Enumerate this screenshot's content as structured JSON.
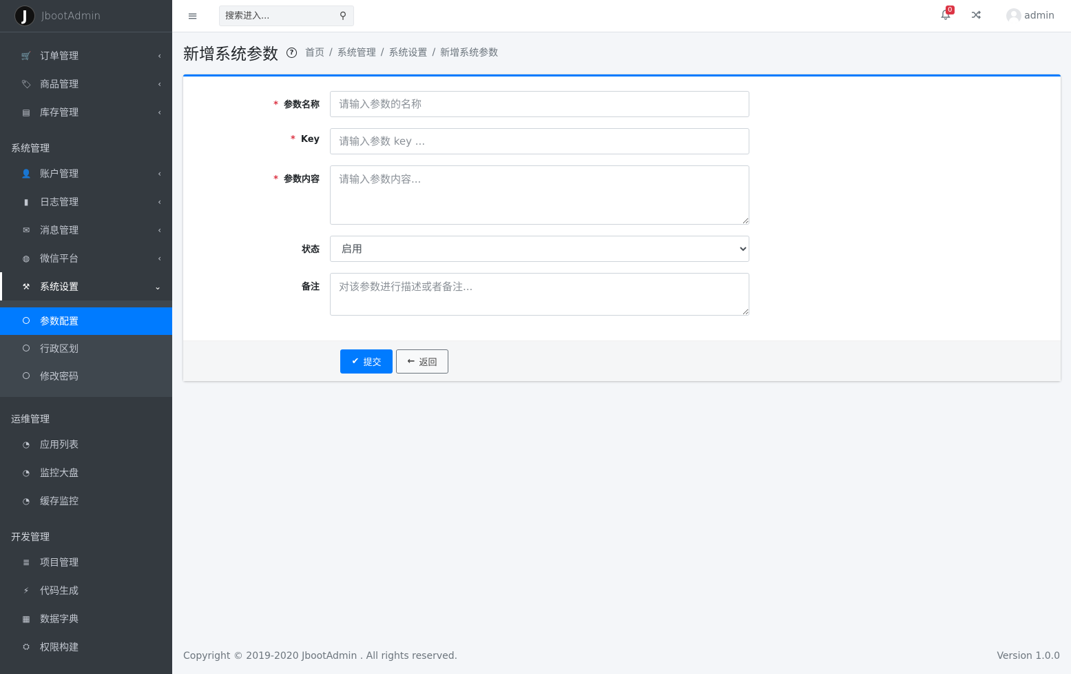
{
  "brand": {
    "logo_letter": "J",
    "name": "JbootAdmin"
  },
  "sidebar": {
    "group1": [
      {
        "icon": "🛒",
        "icon_name": "cart-icon",
        "label": "订单管理",
        "chev": "‹"
      },
      {
        "icon": "🏷",
        "icon_name": "tag-icon",
        "label": "商品管理",
        "chev": "‹"
      },
      {
        "icon": "▤",
        "icon_name": "warehouse-icon",
        "label": "库存管理",
        "chev": "‹"
      }
    ],
    "header_system": "系统管理",
    "group2": [
      {
        "icon": "👤",
        "icon_name": "user-icon",
        "label": "账户管理",
        "chev": "‹"
      },
      {
        "icon": "▮",
        "icon_name": "book-icon",
        "label": "日志管理",
        "chev": "‹"
      },
      {
        "icon": "✉",
        "icon_name": "message-icon",
        "label": "消息管理",
        "chev": "‹"
      },
      {
        "icon": "◍",
        "icon_name": "wechat-icon",
        "label": "微信平台",
        "chev": "‹"
      }
    ],
    "open_item": {
      "icon": "⚒",
      "icon_name": "wrench-icon",
      "label": "系统设置",
      "chev": "⌄"
    },
    "sub_items": [
      {
        "label": "参数配置",
        "active": true
      },
      {
        "label": "行政区划",
        "active": false
      },
      {
        "label": "修改密码",
        "active": false
      }
    ],
    "header_ops": "运维管理",
    "group3": [
      {
        "icon": "◔",
        "icon_name": "dashboard-icon",
        "label": "应用列表"
      },
      {
        "icon": "◔",
        "icon_name": "dashboard-icon",
        "label": "监控大盘"
      },
      {
        "icon": "◔",
        "icon_name": "dashboard-icon",
        "label": "缓存监控"
      }
    ],
    "header_dev": "开发管理",
    "group4": [
      {
        "icon": "≣",
        "icon_name": "database-icon",
        "label": "项目管理"
      },
      {
        "icon": "⚡",
        "icon_name": "bolt-icon",
        "label": "代码生成"
      },
      {
        "icon": "▦",
        "icon_name": "grid-icon",
        "label": "数据字典"
      },
      {
        "icon": "⛭",
        "icon_name": "sitemap-icon",
        "label": "权限构建"
      }
    ]
  },
  "topbar": {
    "menu_icon": "≡",
    "search_placeholder": "搜索进入...",
    "search_icon": "⚲",
    "notifications_count": "0",
    "user_name": "admin"
  },
  "header": {
    "title": "新增系统参数",
    "help": "?",
    "breadcrumb": [
      "首页",
      "系统管理",
      "系统设置",
      "新增系统参数"
    ],
    "sep": "/"
  },
  "form": {
    "name_label": "参数名称",
    "name_placeholder": "请输入参数的名称",
    "key_label": "Key",
    "key_placeholder": "请输入参数 key ...",
    "content_label": "参数内容",
    "content_placeholder": "请输入参数内容...",
    "status_label": "状态",
    "status_value": "启用",
    "remark_label": "备注",
    "remark_placeholder": "对该参数进行描述或者备注...",
    "required_mark": "*",
    "submit_label": "提交",
    "back_label": "返回"
  },
  "footer": {
    "copyright": "Copyright © 2019-2020 JbootAdmin . All rights reserved.",
    "version": "Version 1.0.0"
  }
}
